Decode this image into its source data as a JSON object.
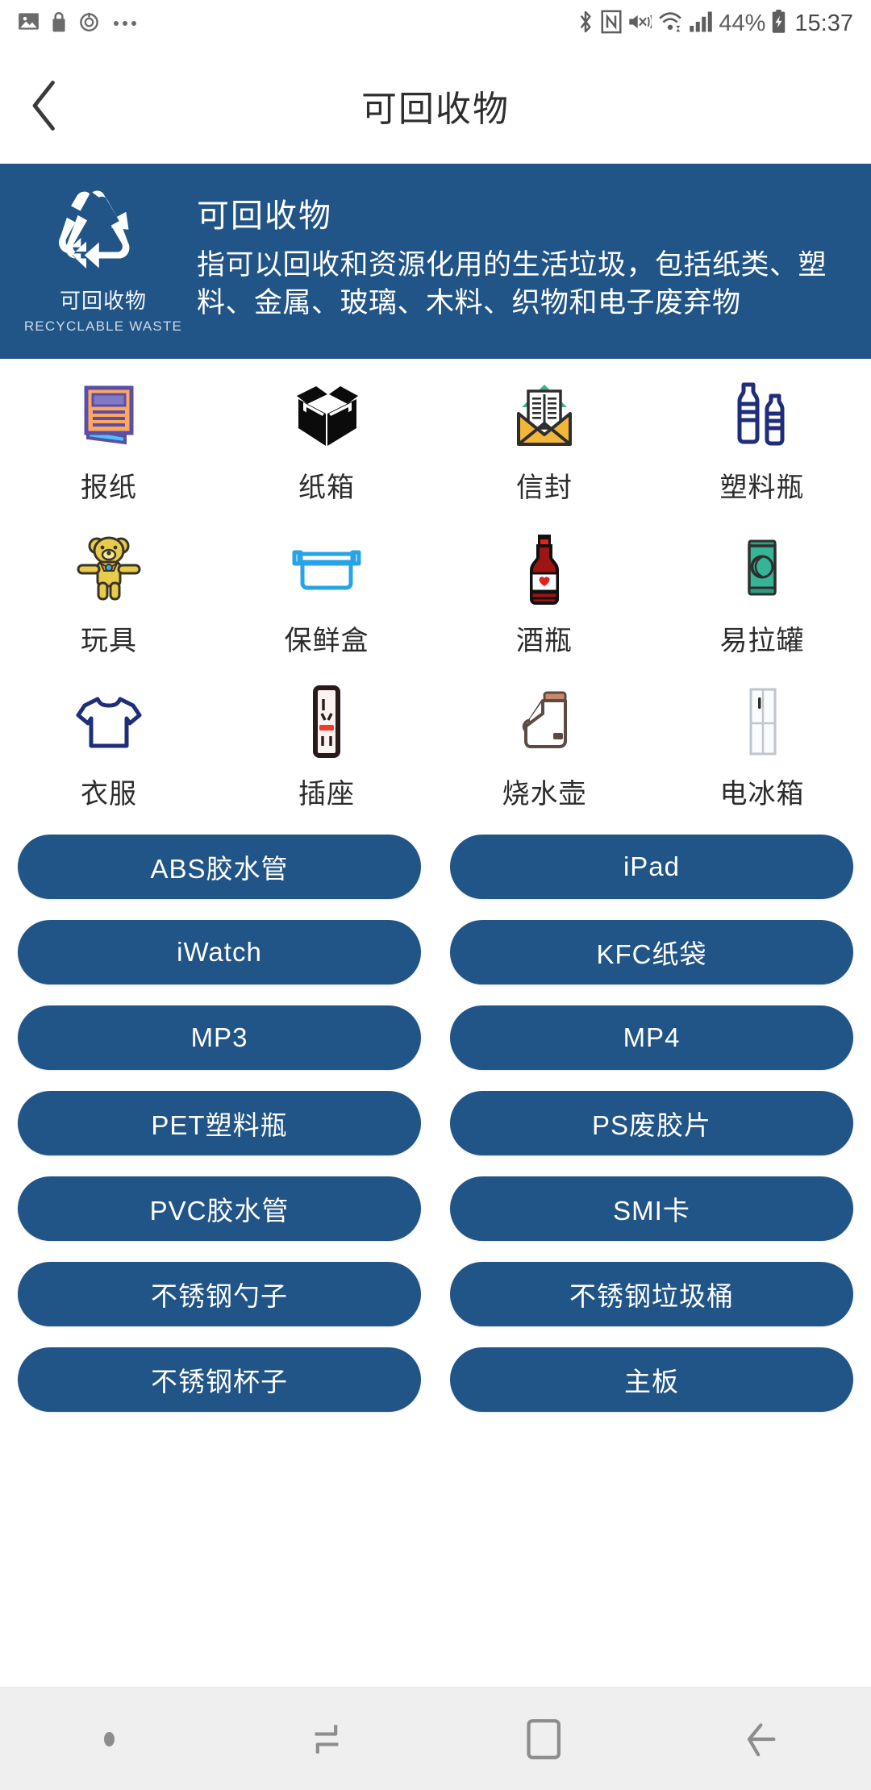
{
  "status_bar": {
    "left_icons": [
      "image-icon",
      "lock-icon",
      "alarm-icon",
      "more-icon"
    ],
    "right_icons": [
      "bluetooth-icon",
      "nfc-icon",
      "mute-vibrate-icon",
      "wifi-icon",
      "signal-icon"
    ],
    "battery_percent": "44%",
    "battery_state": "charging",
    "time": "15:37"
  },
  "app_bar": {
    "back_icon": "chevron-left-icon",
    "title": "可回收物"
  },
  "banner": {
    "bg_color": "#215487",
    "logo_icon": "recycle-icon",
    "logo_label_cn": "可回收物",
    "logo_label_en": "RECYCLABLE WASTE",
    "title": "可回收物",
    "description": "指可以回收和资源化用的生活垃圾，包括纸类、塑料、金属、玻璃、木料、织物和电子废弃物"
  },
  "grid": {
    "rows": [
      [
        {
          "label": "报纸",
          "icon": "newspaper-icon"
        },
        {
          "label": "纸箱",
          "icon": "carton-box-icon"
        },
        {
          "label": "信封",
          "icon": "envelope-icon"
        },
        {
          "label": "塑料瓶",
          "icon": "plastic-bottle-icon"
        }
      ],
      [
        {
          "label": "玩具",
          "icon": "teddy-bear-icon"
        },
        {
          "label": "保鲜盒",
          "icon": "food-container-icon"
        },
        {
          "label": "酒瓶",
          "icon": "wine-bottle-icon"
        },
        {
          "label": "易拉罐",
          "icon": "soda-can-icon"
        }
      ],
      [
        {
          "label": "衣服",
          "icon": "tshirt-icon"
        },
        {
          "label": "插座",
          "icon": "power-socket-icon"
        },
        {
          "label": "烧水壶",
          "icon": "kettle-icon"
        },
        {
          "label": "电冰箱",
          "icon": "refrigerator-icon"
        }
      ]
    ]
  },
  "pill_list": {
    "accent_color": "#215487",
    "rows": [
      [
        "ABS胶水管",
        "iPad"
      ],
      [
        "iWatch",
        "KFC纸袋"
      ],
      [
        "MP3",
        "MP4"
      ],
      [
        "PET塑料瓶",
        "PS废胶片"
      ],
      [
        "PVC胶水管",
        "SMI卡"
      ],
      [
        "不锈钢勺子",
        "不锈钢垃圾桶"
      ],
      [
        "不锈钢杯子",
        "主板"
      ]
    ]
  },
  "nav_bar": {
    "items": [
      {
        "icon": "dot-indicator-icon"
      },
      {
        "icon": "recents-icon"
      },
      {
        "icon": "home-icon"
      },
      {
        "icon": "back-icon"
      }
    ]
  }
}
